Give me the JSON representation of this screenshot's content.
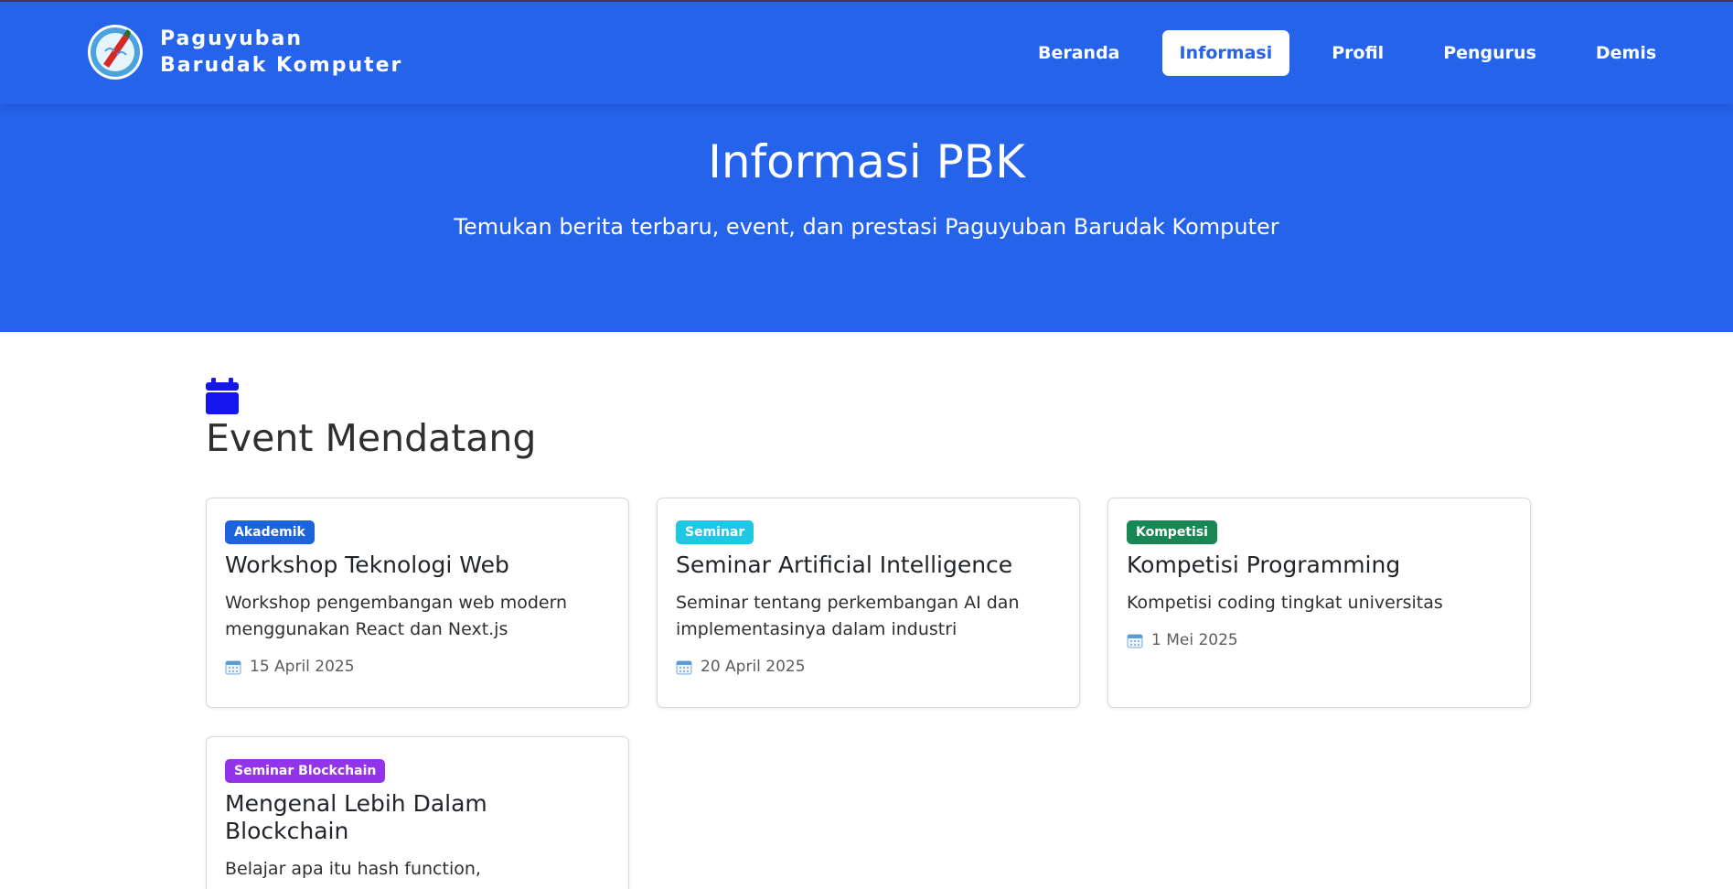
{
  "brand": {
    "line1": "Paguyuban",
    "line2": "Barudak Komputer"
  },
  "nav": {
    "items": [
      {
        "label": "Beranda",
        "active": false
      },
      {
        "label": "Informasi",
        "active": true
      },
      {
        "label": "Profil",
        "active": false
      },
      {
        "label": "Pengurus",
        "active": false
      },
      {
        "label": "Demis",
        "active": false
      }
    ]
  },
  "hero": {
    "title": "Informasi PBK",
    "subtitle": "Temukan berita terbaru, event, dan prestasi Paguyuban Barudak Komputer"
  },
  "section": {
    "title": "Event Mendatang",
    "icon": "calendar-icon"
  },
  "colors": {
    "primary": "#2563eb",
    "section_icon": "#1515f0",
    "badge_akademik": "#1d63dc",
    "badge_seminar": "#1ec8e4",
    "badge_kompetisi": "#198754",
    "badge_blockchain": "#9333ea"
  },
  "events": [
    {
      "badge": "Akademik",
      "badge_color": "#1d63dc",
      "title": "Workshop Teknologi Web",
      "description": "Workshop pengembangan web modern menggunakan React dan Next.js",
      "date": "15 April 2025"
    },
    {
      "badge": "Seminar",
      "badge_color": "#1ec8e4",
      "title": "Seminar Artificial Intelligence",
      "description": "Seminar tentang perkembangan AI dan implementasinya dalam industri",
      "date": "20 April 2025"
    },
    {
      "badge": "Kompetisi",
      "badge_color": "#198754",
      "title": "Kompetisi Programming",
      "description": "Kompetisi coding tingkat universitas",
      "date": "1 Mei 2025"
    },
    {
      "badge": "Seminar Blockchain",
      "badge_color": "#9333ea",
      "title": "Mengenal Lebih Dalam Blockchain",
      "description": "Belajar apa itu hash function,",
      "date": ""
    }
  ]
}
